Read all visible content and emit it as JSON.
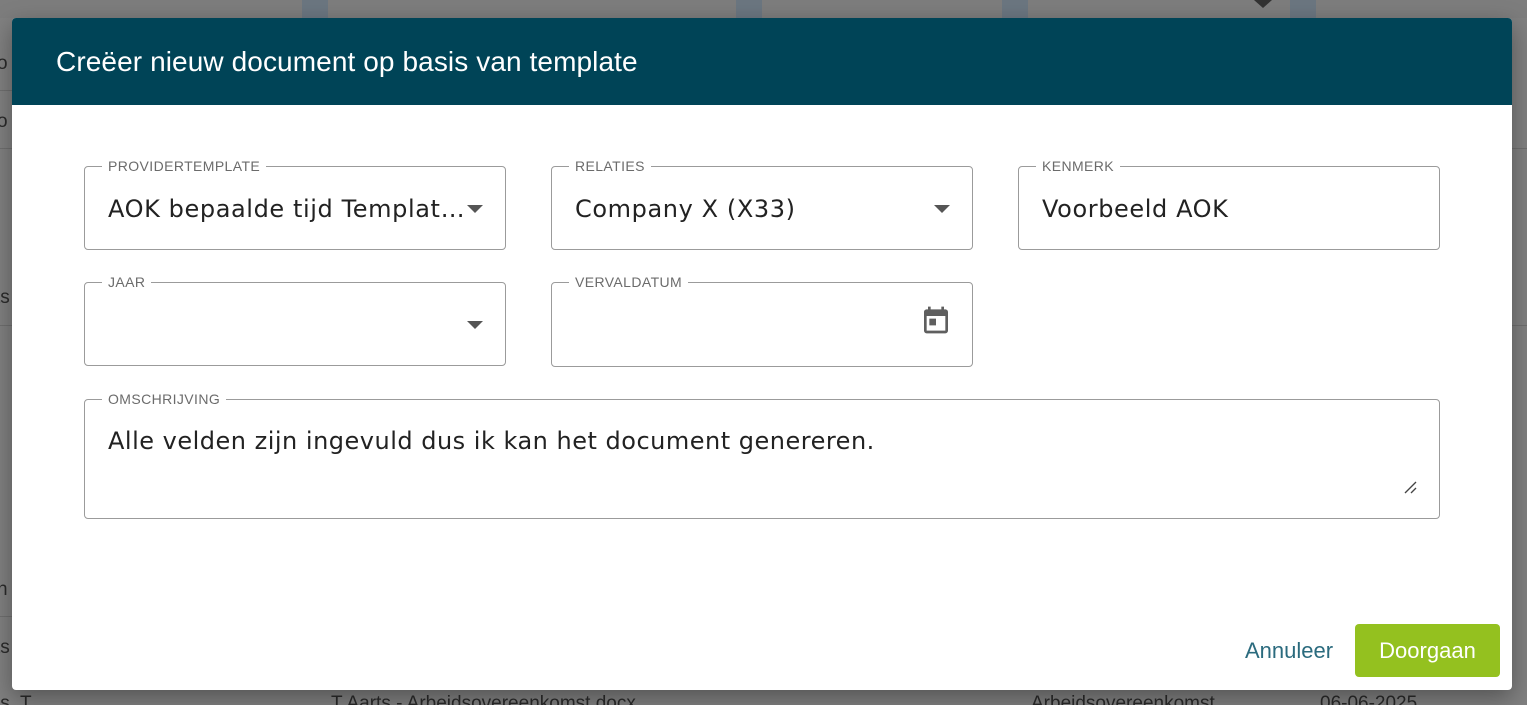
{
  "background": {
    "left_fragments": [
      "o",
      "o",
      "ts",
      "n",
      "ts",
      "ts, T"
    ],
    "bottom_row": {
      "file_name": "T Aarts - Arbeidsovereenkomst.docx",
      "category": "Arbeidsovereenkomst",
      "date": "06-06-2025"
    }
  },
  "dialog": {
    "title": "Creëer nieuw document op basis van template",
    "fields": {
      "providertemplate": {
        "label": "PROVIDERTEMPLATE",
        "value": "AOK bepaalde tijd Template.docx"
      },
      "relaties": {
        "label": "RELATIES",
        "value": "Company X (X33)"
      },
      "kenmerk": {
        "label": "KENMERK",
        "value": "Voorbeeld AOK"
      },
      "jaar": {
        "label": "JAAR",
        "value": ""
      },
      "vervaldatum": {
        "label": "VERVALDATUM",
        "value": ""
      },
      "omschrijving": {
        "label": "OMSCHRIJVING",
        "value": "Alle velden zijn ingevuld dus ik kan het document genereren."
      }
    },
    "actions": {
      "cancel_label": "Annuleer",
      "continue_label": "Doorgaan"
    }
  },
  "icons": {
    "providertemplate_dropdown": "chevron-down-icon",
    "relaties_dropdown": "chevron-down-icon",
    "jaar_dropdown": "chevron-down-icon",
    "vervaldatum_picker": "calendar-icon",
    "omschrijving_resize": "resize-handle-icon"
  },
  "colors": {
    "header": "#004457",
    "primary_button": "#94c11f",
    "cancel_text": "#2b6b7e",
    "overlay": "#808080"
  }
}
